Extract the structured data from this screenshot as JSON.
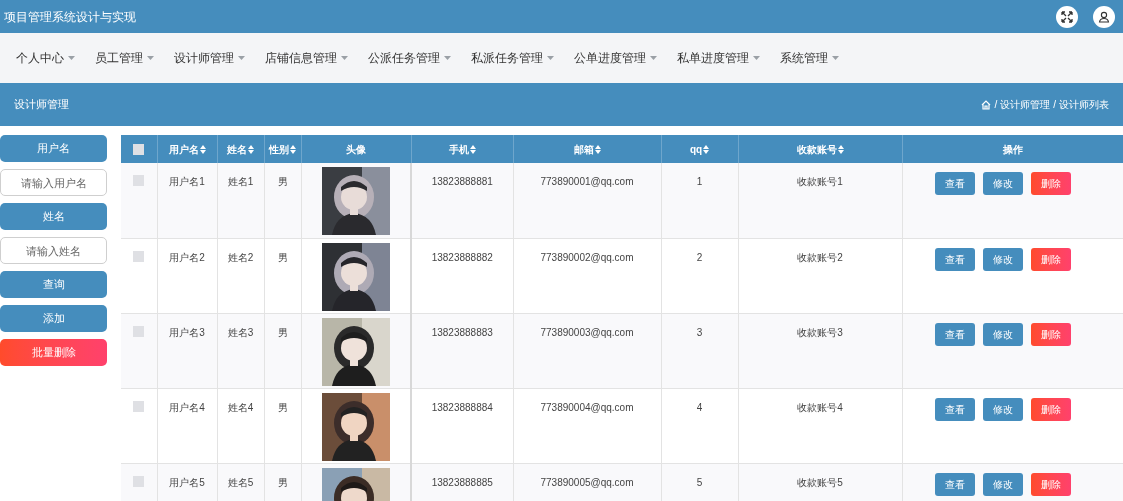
{
  "header": {
    "title": "项目管理系统设计与实现"
  },
  "nav": [
    {
      "label": "个人中心"
    },
    {
      "label": "员工管理"
    },
    {
      "label": "设计师管理"
    },
    {
      "label": "店铺信息管理"
    },
    {
      "label": "公派任务管理"
    },
    {
      "label": "私派任务管理"
    },
    {
      "label": "公单进度管理"
    },
    {
      "label": "私单进度管理"
    },
    {
      "label": "系统管理"
    }
  ],
  "page_bar": {
    "title": "设计师管理",
    "breadcrumb": [
      {
        "separator": "/",
        "label": "设计师管理"
      },
      {
        "separator": "/",
        "label": "设计师列表"
      }
    ]
  },
  "search": [
    {
      "kind": "label",
      "text": "用户名"
    },
    {
      "kind": "field",
      "placeholder": "请输入用户名"
    },
    {
      "kind": "label",
      "text": "姓名"
    },
    {
      "kind": "field",
      "placeholder": "请输入姓名"
    },
    {
      "kind": "button",
      "text": "查询"
    },
    {
      "kind": "button",
      "text": "添加"
    },
    {
      "kind": "danger",
      "text": "批量删除"
    }
  ],
  "table": {
    "columns": [
      {
        "kind": "checkbox",
        "checked": false
      },
      {
        "kind": "text",
        "label": "用户名",
        "sortable": true
      },
      {
        "kind": "text",
        "label": "姓名",
        "sortable": true
      },
      {
        "kind": "text",
        "label": "性别",
        "sortable": true
      },
      {
        "kind": "text",
        "label": "头像",
        "sortable": false
      },
      {
        "kind": "text",
        "label": "手机",
        "sortable": true
      },
      {
        "kind": "text",
        "label": "邮箱",
        "sortable": true
      },
      {
        "kind": "text",
        "label": "qq",
        "sortable": true
      },
      {
        "kind": "text",
        "label": "收款账号",
        "sortable": true
      },
      {
        "kind": "text",
        "label": "操作",
        "sortable": false
      }
    ],
    "rows": [
      {
        "cells": [
          {
            "kind": "checkbox",
            "checked": false
          },
          {
            "kind": "text",
            "text": "用户名1"
          },
          {
            "kind": "text",
            "text": "姓名1"
          },
          {
            "kind": "text",
            "text": "男"
          },
          {
            "kind": "picture"
          },
          {
            "kind": "text",
            "text": "13823888881"
          },
          {
            "kind": "text",
            "text": "773890001@qq.com"
          },
          {
            "kind": "text",
            "text": "1"
          },
          {
            "kind": "text",
            "text": "收款账号1"
          },
          {
            "kind": "actions",
            "buttons": [
              "查看",
              "修改",
              "删除"
            ]
          }
        ]
      },
      {
        "cells": [
          {
            "kind": "checkbox",
            "checked": false
          },
          {
            "kind": "text",
            "text": "用户名2"
          },
          {
            "kind": "text",
            "text": "姓名2"
          },
          {
            "kind": "text",
            "text": "男"
          },
          {
            "kind": "picture"
          },
          {
            "kind": "text",
            "text": "13823888882"
          },
          {
            "kind": "text",
            "text": "773890002@qq.com"
          },
          {
            "kind": "text",
            "text": "2"
          },
          {
            "kind": "text",
            "text": "收款账号2"
          },
          {
            "kind": "actions",
            "buttons": [
              "查看",
              "修改",
              "删除"
            ]
          }
        ]
      },
      {
        "cells": [
          {
            "kind": "checkbox",
            "checked": false
          },
          {
            "kind": "text",
            "text": "用户名3"
          },
          {
            "kind": "text",
            "text": "姓名3"
          },
          {
            "kind": "text",
            "text": "男"
          },
          {
            "kind": "picture"
          },
          {
            "kind": "text",
            "text": "13823888883"
          },
          {
            "kind": "text",
            "text": "773890003@qq.com"
          },
          {
            "kind": "text",
            "text": "3"
          },
          {
            "kind": "text",
            "text": "收款账号3"
          },
          {
            "kind": "actions",
            "buttons": [
              "查看",
              "修改",
              "删除"
            ]
          }
        ]
      },
      {
        "cells": [
          {
            "kind": "checkbox",
            "checked": false
          },
          {
            "kind": "text",
            "text": "用户名4"
          },
          {
            "kind": "text",
            "text": "姓名4"
          },
          {
            "kind": "text",
            "text": "男"
          },
          {
            "kind": "picture"
          },
          {
            "kind": "text",
            "text": "13823888884"
          },
          {
            "kind": "text",
            "text": "773890004@qq.com"
          },
          {
            "kind": "text",
            "text": "4"
          },
          {
            "kind": "text",
            "text": "收款账号4"
          },
          {
            "kind": "actions",
            "buttons": [
              "查看",
              "修改",
              "删除"
            ]
          }
        ]
      },
      {
        "cells": [
          {
            "kind": "checkbox",
            "checked": false
          },
          {
            "kind": "text",
            "text": "用户名5"
          },
          {
            "kind": "text",
            "text": "姓名5"
          },
          {
            "kind": "text",
            "text": "男"
          },
          {
            "kind": "picture"
          },
          {
            "kind": "text",
            "text": "13823888885"
          },
          {
            "kind": "text",
            "text": "773890005@qq.com"
          },
          {
            "kind": "text",
            "text": "5"
          },
          {
            "kind": "text",
            "text": "收款账号5"
          },
          {
            "kind": "actions",
            "buttons": [
              "查看",
              "修改",
              "删除"
            ]
          }
        ]
      }
    ]
  }
}
